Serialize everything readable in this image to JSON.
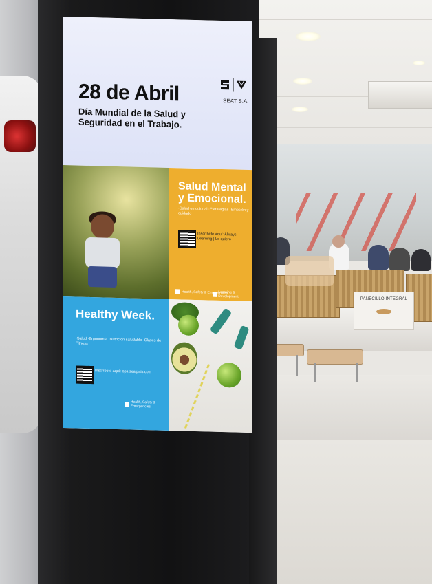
{
  "poster": {
    "date": "28 de Abril",
    "subtitle": "Día Mundial de la Salud y Seguridad en el Trabajo.",
    "brand_label": "SEAT S.A.",
    "mental": {
      "title": "Salud Mental y Emocional.",
      "items": "·Salud emocional ·Estrategias ·Emoción y cuidado",
      "cta": "Inscríbete aquí: Always Learning | Lo quiero",
      "footer_left": "Health, Safety & Emergencies",
      "footer_right": "Learning & Development"
    },
    "healthy": {
      "title": "Healthy Week.",
      "items": "·Salud ·Ergonomía ·Nutrición saludable ·Clases de Fitness",
      "cta": "Inscríbete aquí: ops.seatpais.com",
      "footer": "Health, Safety & Emergencies"
    }
  },
  "scene": {
    "counter_sign": "PANECILLO INTEGRAL"
  },
  "colors": {
    "mental_bg": "#eeae2e",
    "healthy_bg": "#33a6df",
    "header_bg": "#e4e8f9"
  }
}
